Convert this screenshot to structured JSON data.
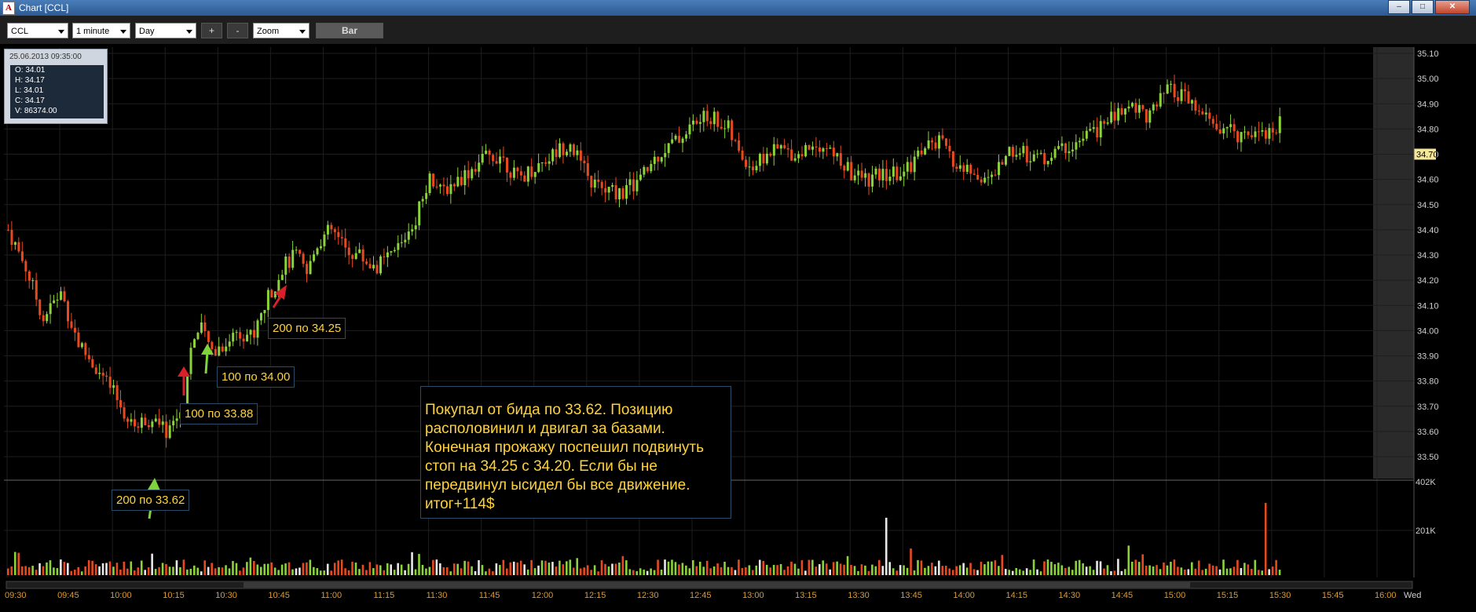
{
  "window": {
    "app_icon": "A",
    "title": "Chart [CCL]",
    "buttons": [
      "–",
      "□",
      "✕"
    ]
  },
  "toolbar": {
    "symbol": "CCL",
    "interval": "1 minute",
    "range": "Day",
    "plus_label": "+",
    "minus_label": "-",
    "zoom_label": "Zoom",
    "bar_label": "Bar"
  },
  "infobox": {
    "datetime": "25.06.2013 09:35:00",
    "lines": [
      "O: 34.01",
      "H: 34.17",
      "L: 34.01",
      "C: 34.17",
      "V: 86374.00"
    ]
  },
  "annotations": {
    "a1": "200 по 33.62",
    "a2": "100 по 33.88",
    "a3": "100 по 34.00",
    "a4": "200 по 34.25",
    "note": "Покупал от бида по 33.62. Позицию\nрасполовинил и двигал за базами.\nКонечная прожажу поспешил подвинуть\nстоп на 34.25 с 34.20. Если бы не\nпередвинул ысидел бы все движение.\nитог+114$"
  },
  "colors": {
    "up": "#8bd23b",
    "down": "#e84a20",
    "grid": "#1e1e1e",
    "axis_text": "#cfcfcf",
    "time_text": "#e09a2a",
    "last_price_bg": "#f4e79a",
    "arrow_green": "#7ed43a",
    "arrow_red": "#d8202a"
  },
  "chart_data": {
    "type": "candlestick",
    "y_ticks": [
      "35.10",
      "35.00",
      "34.90",
      "34.80",
      "34.70",
      "34.60",
      "34.50",
      "34.40",
      "34.30",
      "34.20",
      "34.10",
      "34.00",
      "33.90",
      "33.80",
      "33.70",
      "33.60",
      "33.50"
    ],
    "last_price": "34.70",
    "volume_ticks": [
      "402K",
      "201K"
    ],
    "x_ticks": [
      "09:30",
      "09:45",
      "10:00",
      "10:15",
      "10:30",
      "10:45",
      "11:00",
      "11:15",
      "11:30",
      "11:45",
      "12:00",
      "12:15",
      "12:30",
      "12:45",
      "13:00",
      "13:15",
      "13:30",
      "13:45",
      "14:00",
      "14:15",
      "14:30",
      "14:45",
      "15:00",
      "15:15",
      "15:30",
      "15:45",
      "16:00"
    ],
    "x_end_label": "Wed",
    "price_path": [
      [
        0,
        34.4
      ],
      [
        5,
        34.25
      ],
      [
        10,
        34.05
      ],
      [
        15,
        34.15
      ],
      [
        20,
        33.95
      ],
      [
        25,
        33.85
      ],
      [
        30,
        33.75
      ],
      [
        35,
        33.62
      ],
      [
        40,
        33.65
      ],
      [
        45,
        33.6
      ],
      [
        50,
        33.7
      ],
      [
        52,
        33.95
      ],
      [
        55,
        34.0
      ],
      [
        58,
        33.92
      ],
      [
        62,
        33.95
      ],
      [
        65,
        34.0
      ],
      [
        70,
        33.98
      ],
      [
        73,
        34.1
      ],
      [
        78,
        34.25
      ],
      [
        82,
        34.3
      ],
      [
        85,
        34.22
      ],
      [
        88,
        34.35
      ],
      [
        92,
        34.4
      ],
      [
        96,
        34.32
      ],
      [
        100,
        34.3
      ],
      [
        104,
        34.25
      ],
      [
        108,
        34.28
      ],
      [
        112,
        34.35
      ],
      [
        116,
        34.45
      ],
      [
        120,
        34.62
      ],
      [
        123,
        34.55
      ],
      [
        126,
        34.58
      ],
      [
        130,
        34.62
      ],
      [
        135,
        34.68
      ],
      [
        140,
        34.7
      ],
      [
        145,
        34.6
      ],
      [
        150,
        34.65
      ],
      [
        155,
        34.7
      ],
      [
        160,
        34.75
      ],
      [
        165,
        34.6
      ],
      [
        170,
        34.55
      ],
      [
        175,
        34.55
      ],
      [
        180,
        34.6
      ],
      [
        185,
        34.7
      ],
      [
        190,
        34.75
      ],
      [
        195,
        34.82
      ],
      [
        200,
        34.85
      ],
      [
        205,
        34.8
      ],
      [
        208,
        34.7
      ],
      [
        212,
        34.65
      ],
      [
        216,
        34.7
      ],
      [
        220,
        34.72
      ],
      [
        225,
        34.7
      ],
      [
        230,
        34.75
      ],
      [
        235,
        34.7
      ],
      [
        240,
        34.62
      ],
      [
        245,
        34.6
      ],
      [
        250,
        34.62
      ],
      [
        255,
        34.62
      ],
      [
        260,
        34.72
      ],
      [
        265,
        34.75
      ],
      [
        270,
        34.65
      ],
      [
        275,
        34.62
      ],
      [
        280,
        34.6
      ],
      [
        285,
        34.72
      ],
      [
        290,
        34.7
      ],
      [
        295,
        34.68
      ],
      [
        300,
        34.72
      ],
      [
        305,
        34.75
      ],
      [
        310,
        34.8
      ],
      [
        315,
        34.85
      ],
      [
        320,
        34.9
      ],
      [
        325,
        34.85
      ],
      [
        330,
        34.95
      ],
      [
        335,
        34.92
      ],
      [
        340,
        34.85
      ],
      [
        345,
        34.8
      ],
      [
        350,
        34.78
      ],
      [
        355,
        34.8
      ],
      [
        360,
        34.78
      ],
      [
        362,
        34.85
      ]
    ],
    "volume_spikes": [
      [
        2,
        0.25
      ],
      [
        250,
        0.62
      ],
      [
        358,
        0.78
      ]
    ]
  }
}
